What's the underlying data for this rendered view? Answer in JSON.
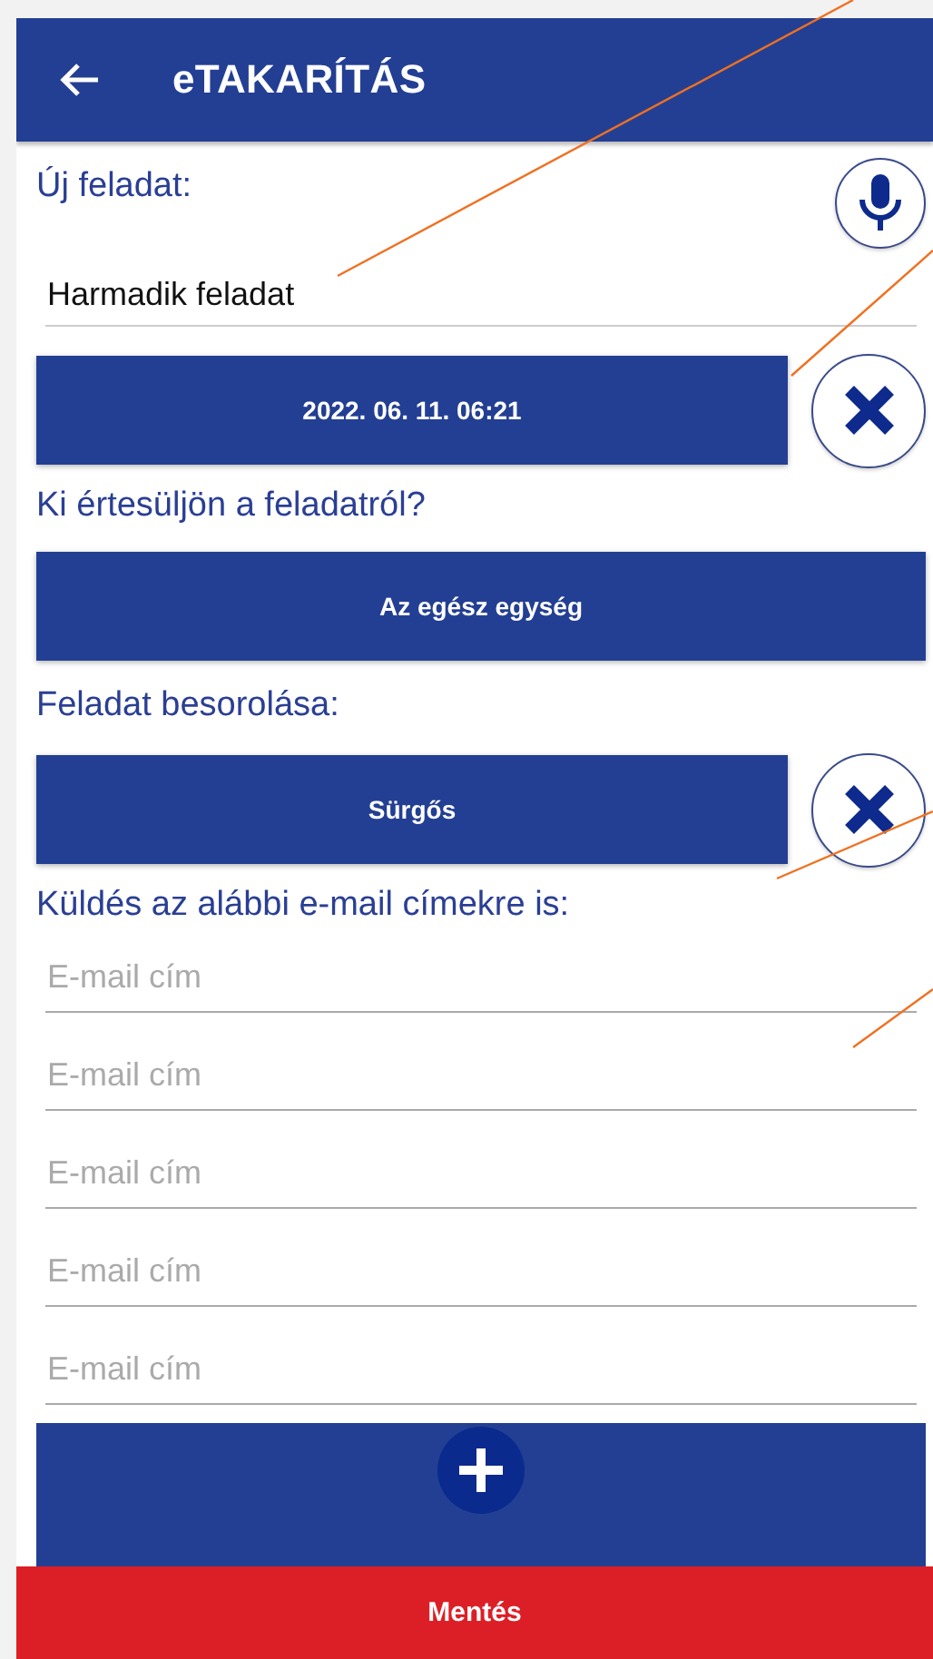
{
  "app_bar": {
    "title": "eTAKARÍTÁS"
  },
  "task": {
    "label": "Új feladat:",
    "value": "Harmadik feladat",
    "date": "2022. 06. 11. 06:21"
  },
  "notify": {
    "label": "Ki értesüljön a feladatról?",
    "button": "Az egész egység"
  },
  "category": {
    "label": "Feladat besorolása:",
    "button": "Sürgős"
  },
  "emails": {
    "label": "Küldés az alábbi e-mail címekre is:",
    "fields": [
      {
        "placeholder": "E-mail cím"
      },
      {
        "placeholder": "E-mail cím"
      },
      {
        "placeholder": "E-mail cím"
      },
      {
        "placeholder": "E-mail cím"
      },
      {
        "placeholder": "E-mail cím"
      }
    ]
  },
  "save_button": "Mentés"
}
